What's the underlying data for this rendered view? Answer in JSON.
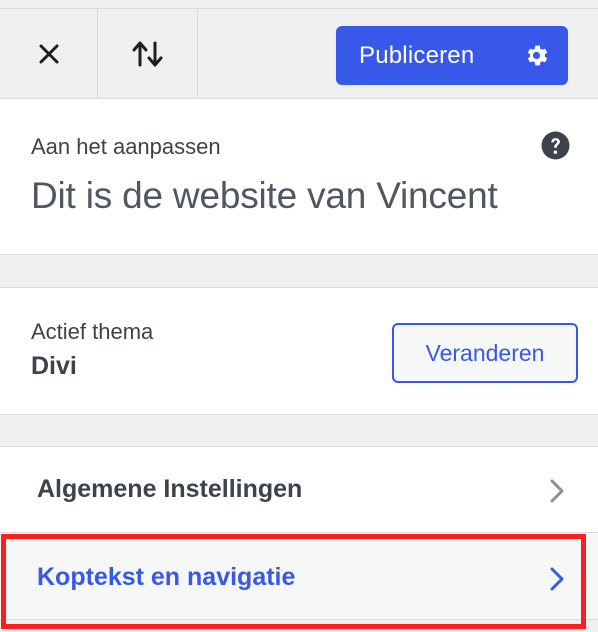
{
  "toolbar": {
    "close_icon": "close-icon",
    "reorder_icon": "reorder-arrows-icon",
    "publish_label": "Publiceren",
    "publish_settings_icon": "gear-icon"
  },
  "site": {
    "label": "Aan het aanpassen",
    "title": "Dit is de website van Vincent",
    "help_icon": "help-icon"
  },
  "theme": {
    "label": "Actief thema",
    "name": "Divi",
    "change_label": "Veranderen"
  },
  "menu": {
    "items": [
      {
        "label": "Algemene Instellingen",
        "icon": "chevron-right-icon"
      },
      {
        "label": "Koptekst en navigatie",
        "icon": "chevron-right-icon",
        "highlighted": true
      }
    ]
  },
  "colors": {
    "accent": "#3858e9",
    "highlight": "#ff1e1e",
    "panel_bg": "#f0f0f1"
  }
}
